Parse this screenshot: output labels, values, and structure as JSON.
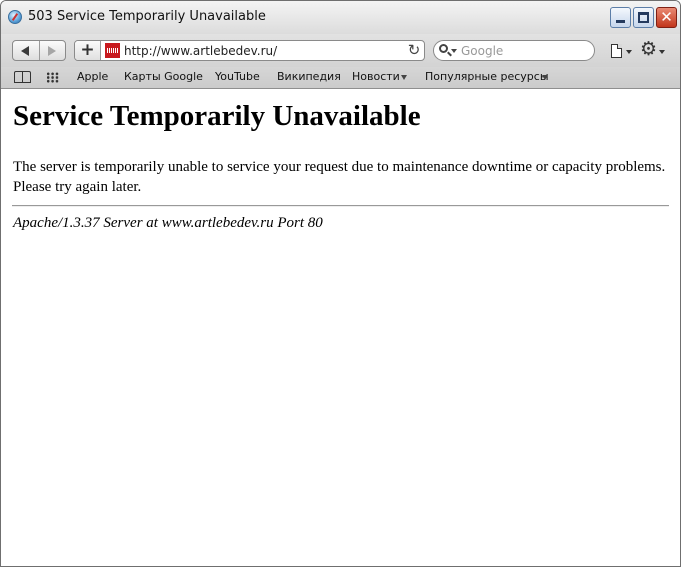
{
  "window": {
    "title": "503 Service Temporarily Unavailable"
  },
  "toolbar": {
    "address": "http://www.artlebedev.ru/",
    "search_placeholder": "Google"
  },
  "bookmarks": {
    "items": [
      "Apple",
      "Карты Google",
      "YouTube",
      "Википедия",
      "Новости",
      "Популярные ресурсы"
    ]
  },
  "page": {
    "heading": "Service Temporarily Unavailable",
    "message": "The server is temporarily unable to service your request due to maintenance downtime or capacity problems. Please try again later.",
    "signature": "Apache/1.3.37 Server at www.artlebedev.ru Port 80"
  }
}
